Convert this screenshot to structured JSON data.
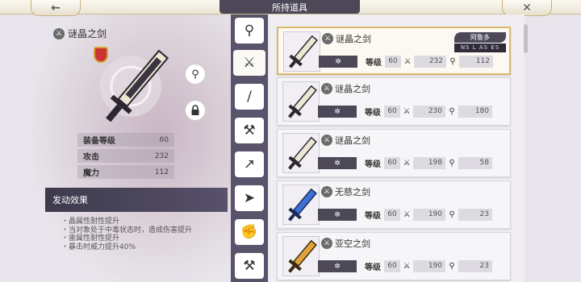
{
  "header": {
    "title": "所持道具",
    "back_icon": "left-arrow-icon",
    "close_icon": "close-icon"
  },
  "detail": {
    "name": "谜晶之剑",
    "stats": [
      {
        "label": "装备等级",
        "value": "60"
      },
      {
        "label": "攻击",
        "value": "232"
      },
      {
        "label": "魔力",
        "value": "112"
      }
    ],
    "effect_title": "发动效果",
    "effects": [
      "・晶属性耐性提升",
      "・当对象处于中毒状态时，造成伤害提升",
      "・雷属性耐性提升",
      "・暴击时威力提升40%"
    ]
  },
  "categories": [
    {
      "icon": "staff-icon"
    },
    {
      "icon": "sword-icon",
      "active": true
    },
    {
      "icon": "katana-icon"
    },
    {
      "icon": "axe-icon"
    },
    {
      "icon": "spear-icon"
    },
    {
      "icon": "bow-icon"
    },
    {
      "icon": "fist-icon"
    },
    {
      "icon": "hammer-icon"
    }
  ],
  "items": [
    {
      "name": "谜晶之剑",
      "star": "✲",
      "level_label": "等级",
      "level": "60",
      "attack": "232",
      "magic": "112",
      "selected": true,
      "owner": "阿鲁多",
      "owner_tag": "NS L AS ES"
    },
    {
      "name": "谜晶之剑",
      "star": "✲",
      "level_label": "等级",
      "level": "60",
      "attack": "230",
      "magic": "180"
    },
    {
      "name": "谜晶之剑",
      "star": "✲",
      "level_label": "等级",
      "level": "60",
      "attack": "198",
      "magic": "58"
    },
    {
      "name": "无慈之剑",
      "star": "✲",
      "level_label": "等级",
      "level": "60",
      "attack": "190",
      "magic": "23"
    },
    {
      "name": "亚空之剑",
      "star": "✲",
      "level_label": "等级",
      "level": "60",
      "attack": "190",
      "magic": "23"
    }
  ]
}
